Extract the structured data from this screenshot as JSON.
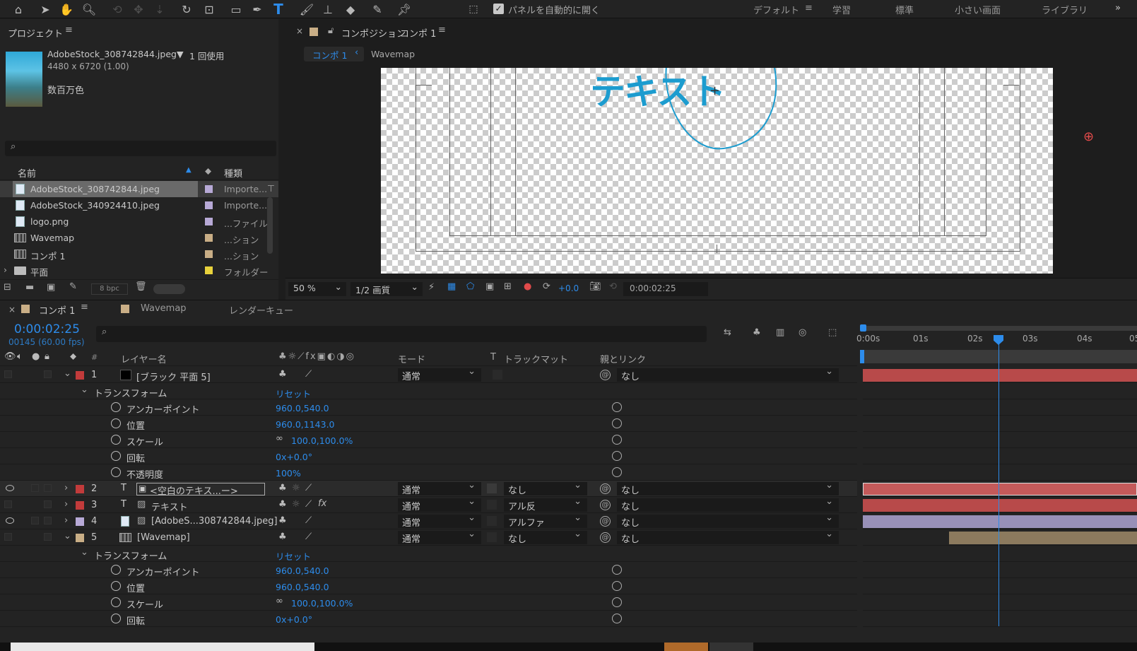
{
  "toolbar": {
    "auto_open_label": "パネルを自動的に開く",
    "workspaces": [
      "デフォルト",
      "学習",
      "標準",
      "小さい画面",
      "ライブラリ"
    ],
    "more": "»"
  },
  "project": {
    "title": "プロジェクト",
    "selected_name": "AdobeStock_308742844.jpeg▼",
    "usage": "1 回使用",
    "dimensions": "4480 x 6720 (1.00)",
    "colors": "数百万色",
    "col_name": "名前",
    "col_type": "種類",
    "items": [
      {
        "name": "AdobeStock_308742844.jpeg",
        "type": "Importe...",
        "color": "#b7a9d6",
        "kind": "file",
        "selected": true
      },
      {
        "name": "AdobeStock_340924410.jpeg",
        "type": "Importe...",
        "color": "#b7a9d6",
        "kind": "file"
      },
      {
        "name": "logo.png",
        "type": "...ファイル",
        "color": "#b7a9d6",
        "kind": "file"
      },
      {
        "name": "Wavemap",
        "type": "...ション",
        "color": "#c9ae86",
        "kind": "comp"
      },
      {
        "name": "コンポ 1",
        "type": "...ション",
        "color": "#c9ae86",
        "kind": "comp"
      },
      {
        "name": "平面",
        "type": "フォルダー",
        "color": "#e8d23c",
        "kind": "folder"
      }
    ],
    "bpc": "8 bpc"
  },
  "viewer": {
    "tab_prefix": "コンポジション",
    "tab_comp": "コンポ 1",
    "crumb1": "コンポ 1",
    "crumb2": "Wavemap",
    "canvas_text": "テキスト",
    "zoom": "50 %",
    "quality": "1/2 画質",
    "exposure": "+0.0",
    "timecode": "0:00:02:25"
  },
  "timeline": {
    "tabs": [
      "コンポ 1",
      "Wavemap",
      "レンダーキュー"
    ],
    "timecode": "0:00:02:25",
    "frames": "00145 (60.00 fps)",
    "col_layer_name": "レイヤー名",
    "col_mode": "モード",
    "col_t": "T",
    "col_trackmatte": "トラックマット",
    "col_parent": "親とリンク",
    "ruler": [
      "0:00s",
      "01s",
      "02s",
      "03s",
      "04s",
      "05"
    ],
    "reset": "リセット",
    "transform": "トランスフォーム",
    "layers": [
      {
        "num": "1",
        "name": "[ブラック 平面 5]",
        "color": "#c23b3b",
        "mode": "通常",
        "matte": "",
        "parent": "なし"
      },
      {
        "num": "2",
        "name": "<空白のテキス...ー>",
        "color": "#c23b3b",
        "mode": "通常",
        "matte": "なし",
        "parent": "なし"
      },
      {
        "num": "3",
        "name": "テキスト",
        "color": "#c23b3b",
        "mode": "通常",
        "matte": "アル反",
        "parent": "なし"
      },
      {
        "num": "4",
        "name": "[AdobeS...308742844.jpeg]",
        "color": "#b7a9d6",
        "mode": "通常",
        "matte": "アルファ",
        "parent": "なし"
      },
      {
        "num": "5",
        "name": "[Wavemap]",
        "color": "#c9ae86",
        "mode": "通常",
        "matte": "なし",
        "parent": "なし"
      }
    ],
    "props1": [
      {
        "name": "アンカーポイント",
        "value": "960.0,540.0"
      },
      {
        "name": "位置",
        "value": "960.0,1143.0"
      },
      {
        "name": "スケール",
        "value": "100.0,100.0%"
      },
      {
        "name": "回転",
        "value": "0x+0.0°"
      },
      {
        "name": "不透明度",
        "value": "100%"
      }
    ],
    "props5": [
      {
        "name": "アンカーポイント",
        "value": "960.0,540.0"
      },
      {
        "name": "位置",
        "value": "960.0,540.0"
      },
      {
        "name": "スケール",
        "value": "100.0,100.0%"
      },
      {
        "name": "回転",
        "value": "0x+0.0°"
      }
    ]
  }
}
